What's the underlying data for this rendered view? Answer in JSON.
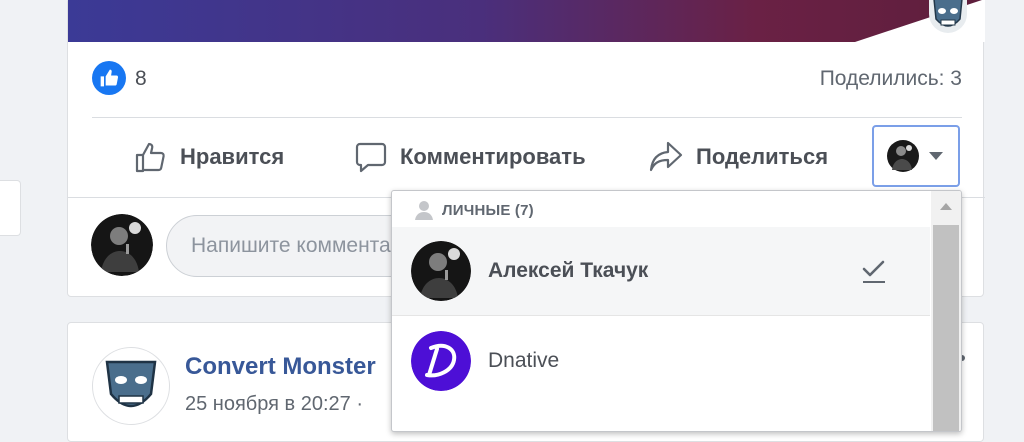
{
  "post": {
    "like_count": "8",
    "shares_label": "Поделились: 3",
    "actions": {
      "like": "Нравится",
      "comment": "Комментировать",
      "share": "Поделиться"
    },
    "comment_placeholder": "Напишите комментарий..."
  },
  "audience_menu": {
    "section_title": "ЛИЧНЫЕ (7)",
    "items": [
      {
        "name": "Алексей Ткачук",
        "selected": true
      },
      {
        "name": "Dnative",
        "selected": false
      }
    ]
  },
  "next_post": {
    "page_name": "Convert Monster",
    "date": "25 ноября в 20:27 ·"
  },
  "colors": {
    "accent_blue": "#1877f2",
    "link_blue": "#385898",
    "dnative_purple": "#4d0fd6"
  },
  "icons": [
    "like-badge-icon",
    "thumbs-up-icon",
    "comment-icon",
    "share-icon",
    "caret-down-icon",
    "person-icon",
    "checkmark-icon",
    "scroll-up-icon",
    "more-icon"
  ]
}
